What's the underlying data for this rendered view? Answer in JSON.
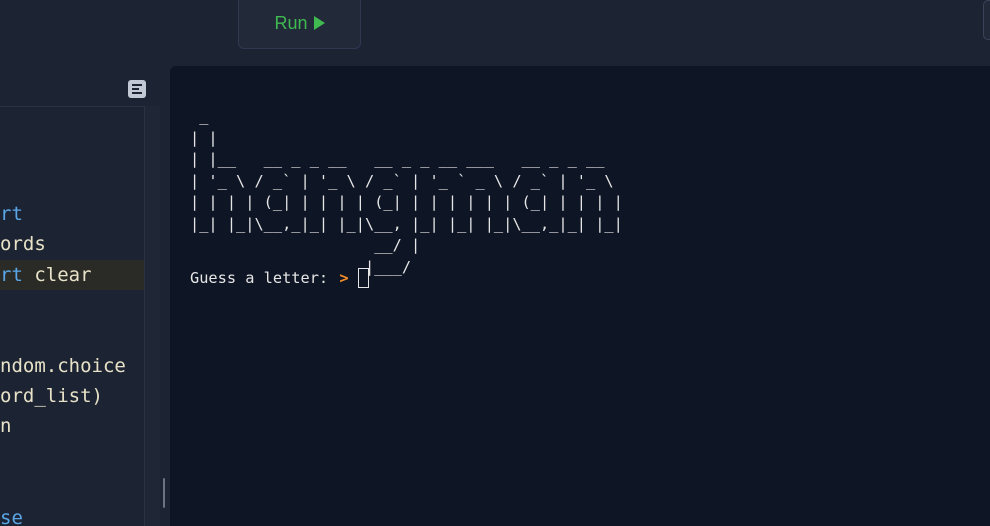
{
  "toolbar": {
    "run_label": "Run",
    "run_icon": "play-icon",
    "accent": "#3fb950"
  },
  "editor": {
    "outline_icon": "outline-icon",
    "lines": [
      {
        "pre": "",
        "kw": "rt",
        "post": ""
      },
      {
        "pre": "ords",
        "kw": "",
        "post": ""
      },
      {
        "pre": "",
        "kw": "rt",
        "post": " clear"
      },
      {
        "pre": "ndom.choice",
        "kw": "",
        "post": ""
      },
      {
        "pre": "ord_list)",
        "kw": "",
        "post": ""
      },
      {
        "pre": "n",
        "kw": "",
        "post": ""
      },
      {
        "pre": "",
        "kw": "se",
        "post": ""
      }
    ]
  },
  "console": {
    "ascii_art": " _\n| |\n| |__   __ _ _ __   __ _ _ __ ___   __ _ _ __\n| '_ \\ / _` | '_ \\ / _` | '_ ` _ \\ / _` | '_ \\\n| | | | (_| | | | | (_| | | | | | | (_| | | | |\n|_| |_|\\__,_|_| |_|\\__, |_| |_| |_|\\__,_|_| |_|\n                    __/ |\n                   |___/",
    "prompt_text": "Guess a letter: ",
    "prompt_marker": ">",
    "prompt_color": "#f28c28"
  }
}
